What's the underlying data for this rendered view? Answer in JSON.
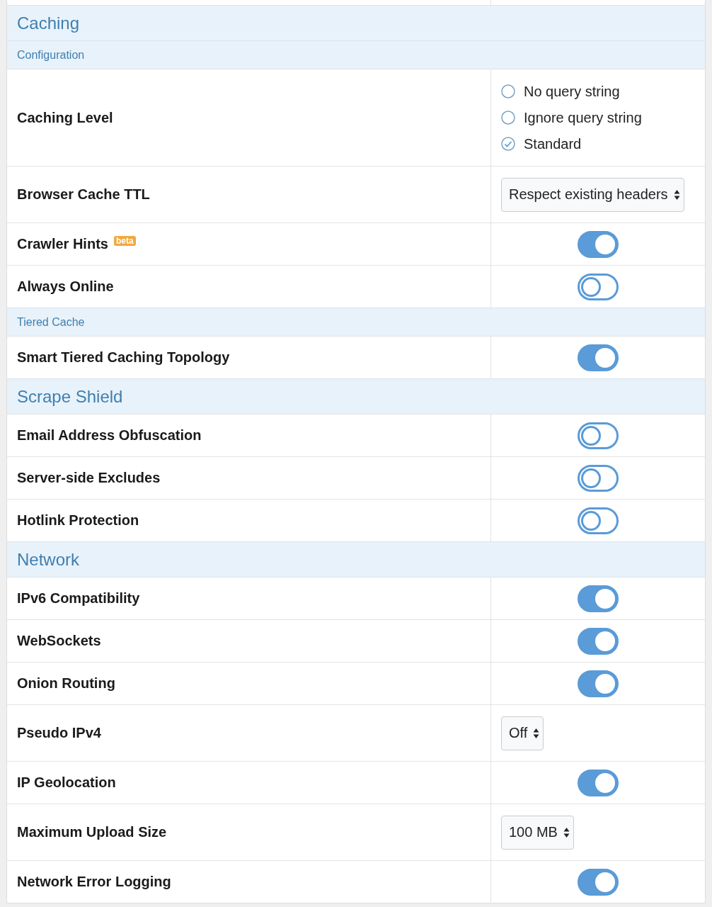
{
  "rows": [
    {
      "kind": "section",
      "title": "Caching"
    },
    {
      "kind": "subsection",
      "title": "Configuration"
    },
    {
      "kind": "radio",
      "label": "Caching Level",
      "options": [
        {
          "label": "No query string",
          "selected": false
        },
        {
          "label": "Ignore query string",
          "selected": false
        },
        {
          "label": "Standard",
          "selected": true
        }
      ]
    },
    {
      "kind": "select",
      "label": "Browser Cache TTL",
      "value": "Respect existing headers"
    },
    {
      "kind": "toggle",
      "label": "Crawler Hints",
      "badge": "beta",
      "on": true
    },
    {
      "kind": "toggle",
      "label": "Always Online",
      "on": false
    },
    {
      "kind": "subsection",
      "title": "Tiered Cache"
    },
    {
      "kind": "toggle",
      "label": "Smart Tiered Caching Topology",
      "on": true
    },
    {
      "kind": "section",
      "title": "Scrape Shield"
    },
    {
      "kind": "toggle",
      "label": "Email Address Obfuscation",
      "on": false
    },
    {
      "kind": "toggle",
      "label": "Server-side Excludes",
      "on": false
    },
    {
      "kind": "toggle",
      "label": "Hotlink Protection",
      "on": false
    },
    {
      "kind": "section",
      "title": "Network"
    },
    {
      "kind": "toggle",
      "label": "IPv6 Compatibility",
      "on": true
    },
    {
      "kind": "toggle",
      "label": "WebSockets",
      "on": true
    },
    {
      "kind": "toggle",
      "label": "Onion Routing",
      "on": true
    },
    {
      "kind": "select",
      "label": "Pseudo IPv4",
      "value": "Off"
    },
    {
      "kind": "toggle",
      "label": "IP Geolocation",
      "on": true
    },
    {
      "kind": "select",
      "label": "Maximum Upload Size",
      "value": "100 MB"
    },
    {
      "kind": "toggle",
      "label": "Network Error Logging",
      "on": true
    }
  ]
}
